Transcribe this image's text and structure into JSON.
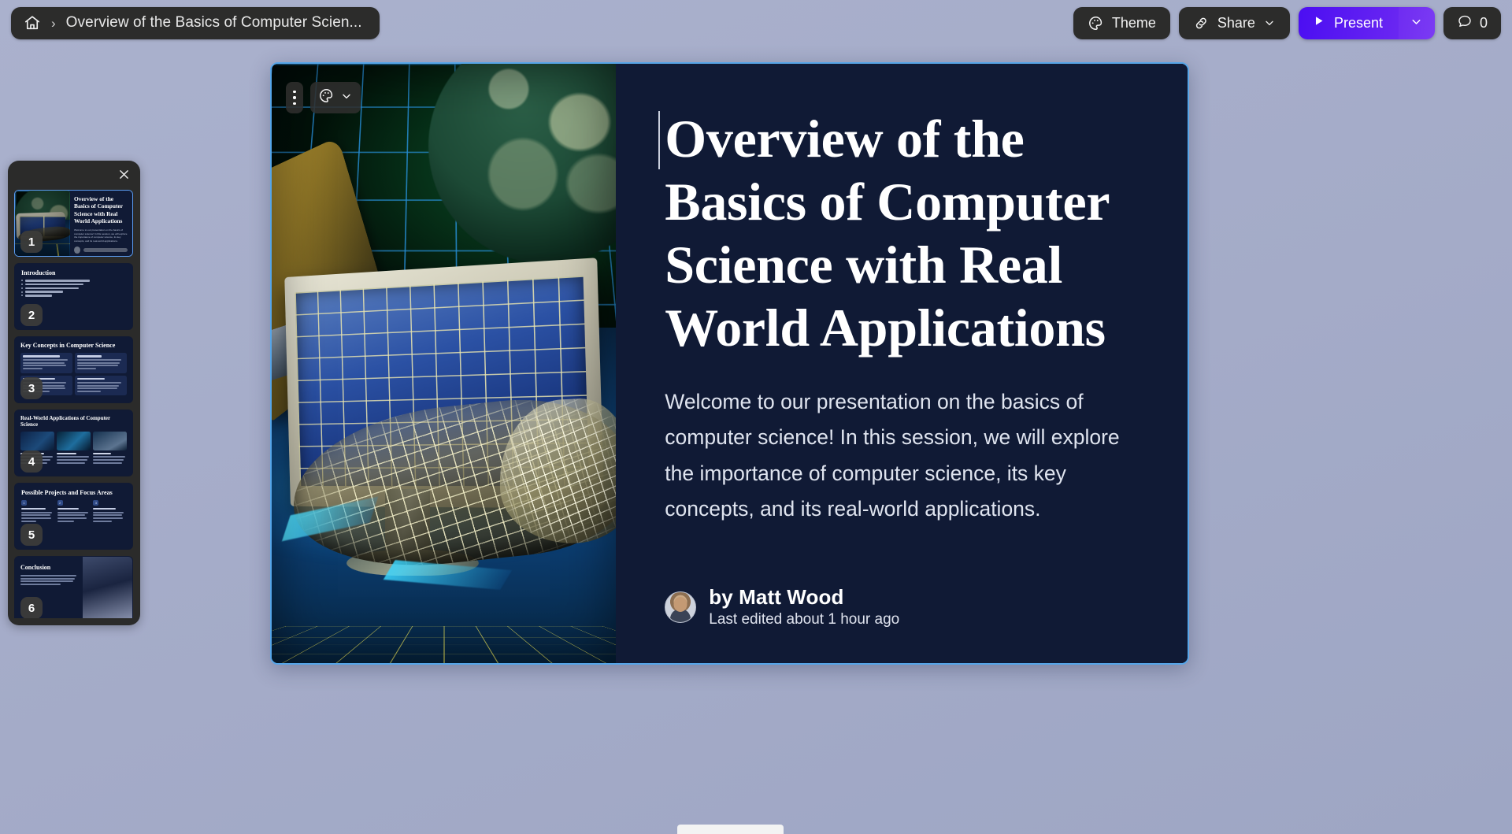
{
  "topbar": {
    "home_icon": "home-icon",
    "separator": "›",
    "breadcrumb_title": "Overview of the Basics of Computer Scien...",
    "theme_label": "Theme",
    "theme_icon": "palette-icon",
    "share_label": "Share",
    "share_icon": "link-icon",
    "share_chevron_icon": "chevron-down-icon",
    "present_label": "Present",
    "present_icon": "play-icon",
    "present_chevron_icon": "chevron-down-icon",
    "comment_count": "0",
    "comment_icon": "comment-icon",
    "accent_color": "#4d0ff0",
    "bar_bg_color": "#2c2c2b"
  },
  "slide_panel": {
    "close_icon": "close-icon",
    "active_slide": 1,
    "slides": [
      {
        "number": "1",
        "title": "Overview of the Basics of Computer Science with Real World Applications",
        "body": "Welcome to our presentation on the basics of computer science! In this session, we will explore the importance of computer science, its key concepts, and its real-world applications.",
        "layout": "title-with-image"
      },
      {
        "number": "2",
        "title": "Introduction",
        "layout": "bullets",
        "bullets": [
          "Importance of Computer Science",
          "Definition of Computer Science",
          "History of Computer Science",
          "Key Components",
          "Overview"
        ]
      },
      {
        "number": "3",
        "title": "Key Concepts in Computer Science",
        "layout": "grid-2x2",
        "cards": [
          {
            "heading": "Algorithms and Problem-Solving",
            "text": "Explore the fundamental building blocks of computer science and learn how to solve problems effectively using algorithms."
          },
          {
            "heading": "Data Structures",
            "text": "Discover the different ways to organize and store data, from arrays to trees and learn how they impact computing efficiency."
          },
          {
            "heading": "Programming Languages",
            "text": "Learn about a diverse range of programming languages and their unique features helping developers to create modern applications."
          },
          {
            "heading": "Artificial Intelligence",
            "text": "Delve into the exciting field of artificial intelligence, where machines mimic human intelligence to perform tasks and make decisions."
          }
        ]
      },
      {
        "number": "4",
        "title": "Real-World Applications of Computer Science",
        "layout": "image-cards-3",
        "cards": [
          {
            "heading": "Machine Learning",
            "text": "Discover how machines learn and improve from data without explicit programming."
          },
          {
            "heading": "Cybersecurity",
            "text": "Explore the vital field of cybersecurity and learn how computer scientists protect systems, networks, and data from unauthorized access or attacks."
          },
          {
            "heading": "Data Analysis",
            "text": "See how computer science techniques are used to extract insights from volumes of data, enabling informed decision-making across various industries."
          }
        ]
      },
      {
        "number": "5",
        "title": "Possible Projects and Focus Areas",
        "layout": "numbered-3",
        "cards": [
          {
            "index": "1",
            "heading": "Artificial Intelligence",
            "text": "Explore the fascinating field of AI and its applications in areas such as natural language processing, computer vision and robotics."
          },
          {
            "index": "2",
            "heading": "Internet of Things",
            "text": "Discover how computer science is revolutionizing the way we interact with everyday objects through interconnected devices and smart systems."
          },
          {
            "index": "3",
            "heading": "Software Engineering",
            "text": "Learn about the process of designing, developing, and maintaining software systems, and explore the principles of data modeling, testing and project management."
          }
        ]
      },
      {
        "number": "6",
        "title": "Conclusion",
        "layout": "text-with-image",
        "body": "Computer science is a fascinating and ever-evolving field that underlies many aspects of modern life. By mastering its basics and real-world applications, we can unlock countless opportunities."
      }
    ]
  },
  "slide_tools": {
    "more_icon": "more-vertical-icon",
    "palette_icon": "palette-icon",
    "palette_chevron_icon": "chevron-down-icon"
  },
  "main_slide": {
    "title": "Overview of the Basics of Computer Science with Real World Applications",
    "body": "Welcome to our presentation on the basics of computer science! In this session, we will explore the importance of computer science, its key concepts, and its real-world applications.",
    "author_name": "by Matt Wood",
    "last_edited": "Last edited about 1 hour ago",
    "avatar_icon": "avatar",
    "background_color": "#101a35",
    "selection_border_color": "#56a5e8",
    "image_alt": "retro 3d render of a wireframe hand reaching out of a computer monitor with a globe and grid background"
  }
}
